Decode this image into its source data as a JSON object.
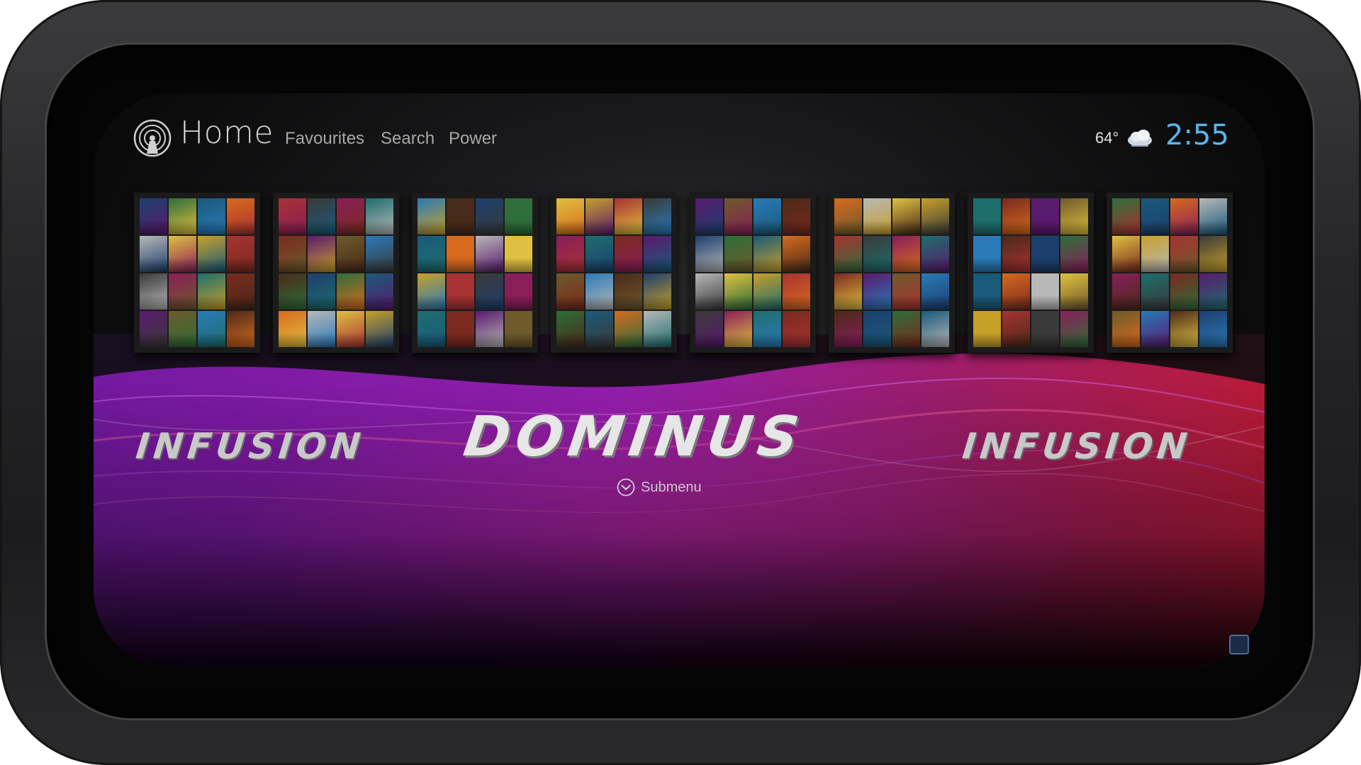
{
  "header": {
    "title": "Home",
    "nav": [
      {
        "label": "Favourites"
      },
      {
        "label": "Search"
      },
      {
        "label": "Power"
      }
    ],
    "logo_icon": "kodi-signal-icon"
  },
  "status": {
    "temperature": "64°",
    "weather_icon": "cloud-icon",
    "time": "2:55"
  },
  "tiles": [
    {
      "name": "collection-1"
    },
    {
      "name": "collection-2"
    },
    {
      "name": "collection-3"
    },
    {
      "name": "collection-4"
    },
    {
      "name": "collection-5"
    },
    {
      "name": "collection-6"
    },
    {
      "name": "collection-7"
    },
    {
      "name": "collection-8"
    }
  ],
  "main_menu": {
    "prev_item": "INFUSION",
    "current_item": "DOMINUS",
    "next_item": "INFUSION",
    "submenu_label": "Submenu",
    "submenu_icon": "chevron-down-circle-icon"
  },
  "colors": {
    "clock": "#5ab6ee",
    "accent_purple": "#8a1fb8",
    "accent_red": "#c4204a",
    "text_primary": "#d8d8d8",
    "text_secondary": "#a8a8a8"
  }
}
